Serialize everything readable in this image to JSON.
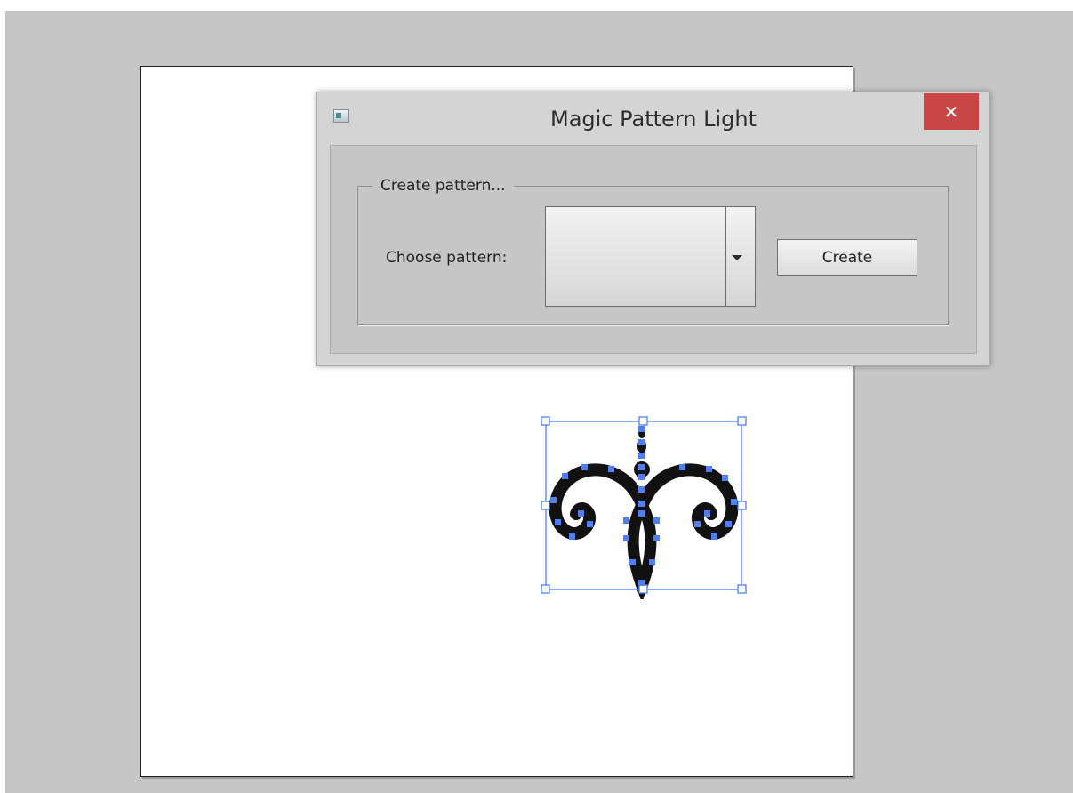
{
  "dialog": {
    "title": "Magic Pattern Light",
    "close_label": "✕",
    "group_title": "Create pattern...",
    "choose_label": "Choose pattern:",
    "pattern_select": {
      "selected": ""
    },
    "create_label": "Create"
  },
  "canvas": {
    "selected_object": "ornament-scroll",
    "selection_color": "#4f7ff0",
    "stroke_color": "#111111"
  }
}
